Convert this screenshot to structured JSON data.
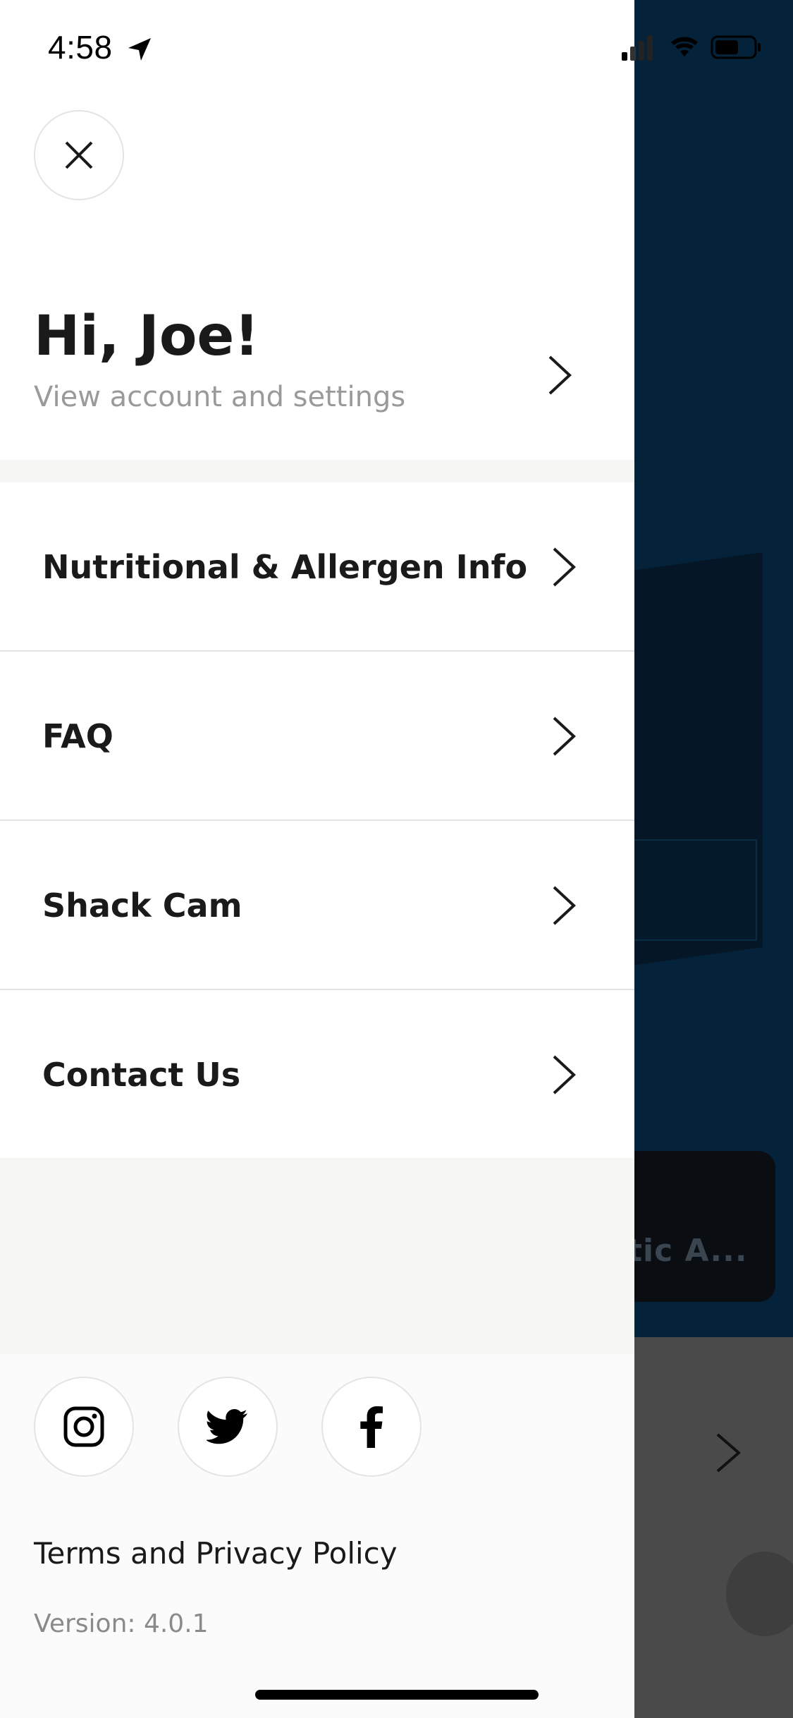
{
  "status_bar": {
    "time": "4:58",
    "icons": [
      "location-arrow-icon",
      "cellular-signal-icon",
      "wifi-icon",
      "battery-icon"
    ]
  },
  "drawer": {
    "close_icon": "close-icon",
    "greeting": "Hi, Joe!",
    "account_link": "View account and settings",
    "menu_items": [
      {
        "label": "Nutritional & Allergen Info"
      },
      {
        "label": "FAQ"
      },
      {
        "label": "Shack Cam"
      },
      {
        "label": "Contact Us"
      }
    ],
    "social": [
      "instagram-icon",
      "twitter-icon",
      "facebook-icon"
    ],
    "terms_link": "Terms and Privacy Policy",
    "version": "Version: 4.0.1"
  },
  "background": {
    "card_text": "tic A..."
  },
  "colors": {
    "background_app": "#04233a",
    "drawer": "#ffffff",
    "text_primary": "#1a1a1a",
    "text_secondary": "#9a9a9a"
  }
}
